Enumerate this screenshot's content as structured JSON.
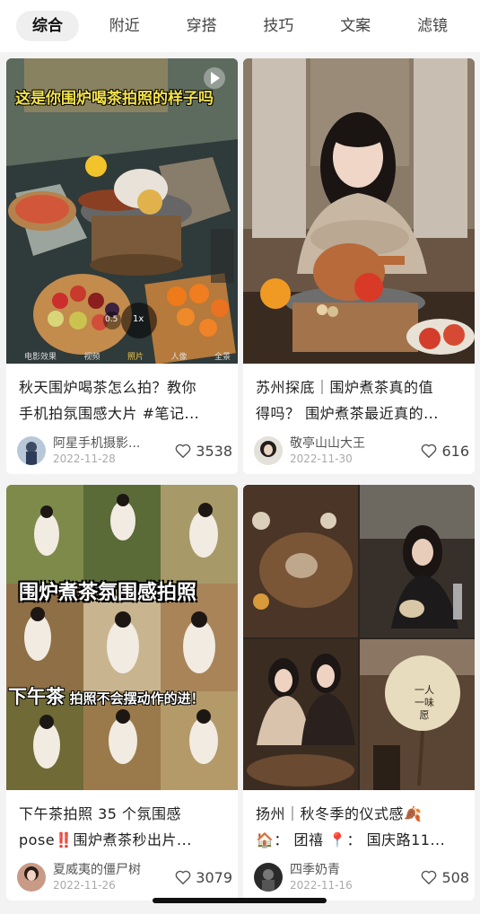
{
  "tabs": [
    "综合",
    "附近",
    "穿搭",
    "技巧",
    "文案",
    "滤镜"
  ],
  "cards": [
    {
      "overlay": "这是你围炉喝茶拍照的样子吗",
      "camera_modes": [
        "电影效果",
        "视频",
        "照片",
        "人像",
        "全景"
      ],
      "zoom_labels": [
        "0.5",
        "1x"
      ],
      "title_line1": "秋天围炉喝茶怎么拍？教你",
      "title_line2": "手机拍氛围感大片 #笔记...",
      "author": "阿星手机摄影...",
      "date": "2022-11-28",
      "likes": "3538"
    },
    {
      "title_line1": "苏州探底｜围炉煮茶真的值",
      "title_line2": "得吗？ 围炉煮茶最近真的...",
      "author": "敬亭山山大王",
      "date": "2022-11-30",
      "likes": "616"
    },
    {
      "overlay1": "围炉煮茶氛围感拍照",
      "overlay2_a": "下午茶",
      "overlay2_b": "拍照不会摆动作的进！",
      "title_line1": "下午茶拍照 35 个氛围感",
      "title_line2": "pose‼️围炉煮茶秒出片...",
      "author": "夏威夷的僵尸树",
      "date": "2022-11-26",
      "likes": "3079"
    },
    {
      "fan_text": [
        "一人",
        "一味",
        "愿"
      ],
      "title_line1": "扬州｜秋冬季的仪式感🍂",
      "title_line2": "🏠： 团禧 📍： 国庆路11...",
      "author": "四季奶青",
      "date": "2022-11-16",
      "likes": "508"
    }
  ]
}
